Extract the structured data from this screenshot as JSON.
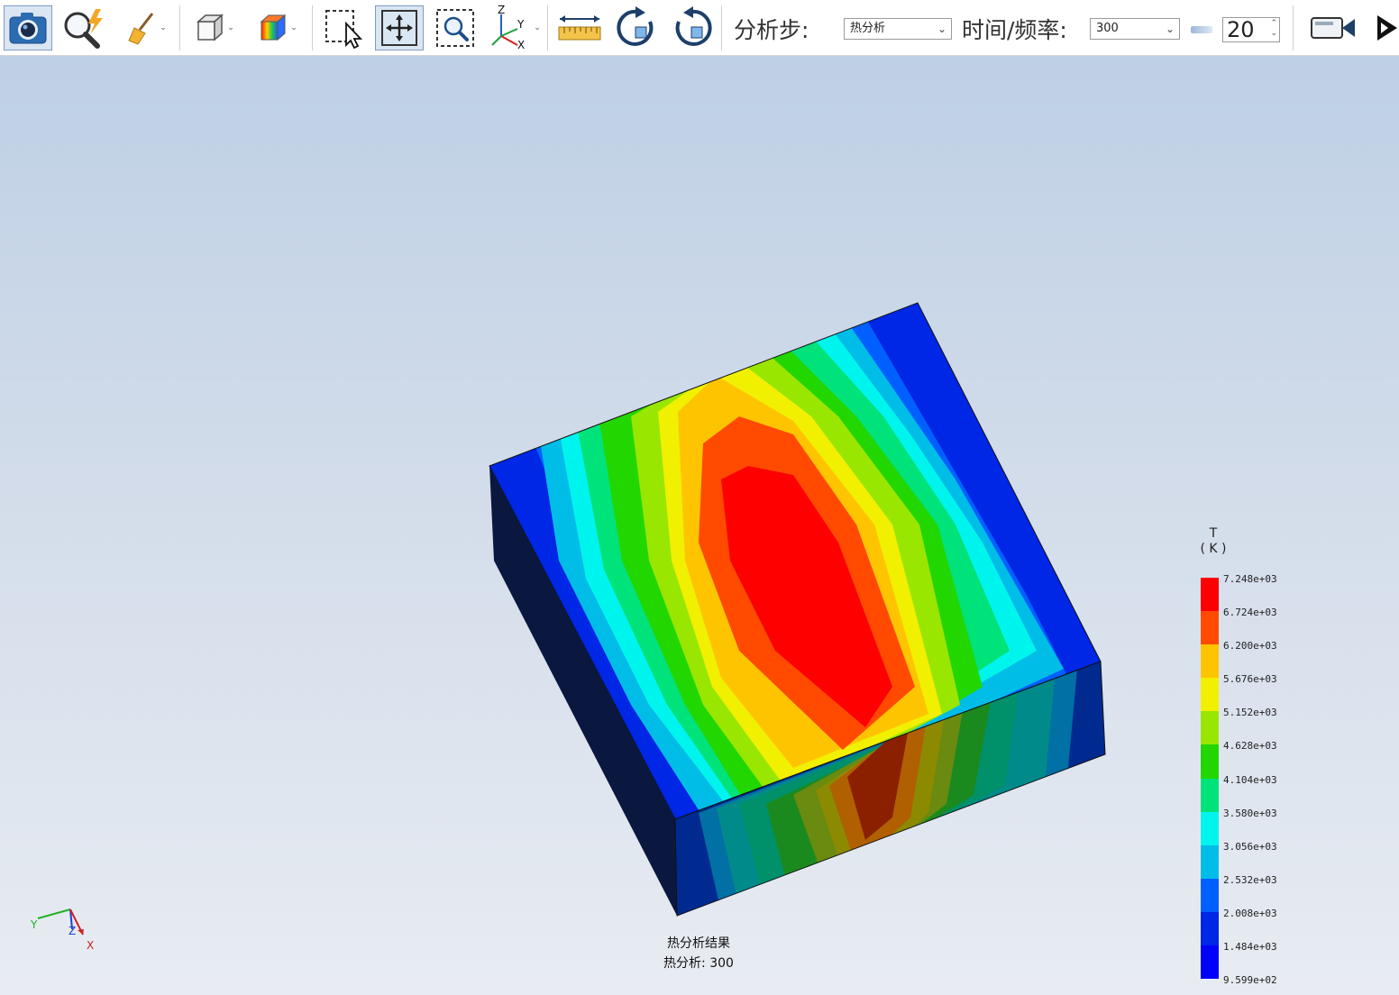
{
  "toolbar": {
    "buttons": [
      {
        "name": "screenshot",
        "icon": "camera-icon"
      },
      {
        "name": "quick-zoom",
        "icon": "magnifier-lightning-icon"
      },
      {
        "name": "clean",
        "icon": "broom-icon"
      },
      {
        "name": "view-cube",
        "icon": "cube-icon"
      },
      {
        "name": "contour",
        "icon": "color-contour-icon"
      },
      {
        "name": "select",
        "icon": "box-select-icon"
      },
      {
        "name": "pan",
        "icon": "pan-arrows-icon"
      },
      {
        "name": "zoom-window",
        "icon": "zoom-window-icon"
      },
      {
        "name": "axes",
        "icon": "xyz-axes-icon"
      },
      {
        "name": "measure",
        "icon": "ruler-icon"
      },
      {
        "name": "rotate-cw",
        "icon": "rotate-clockwise-icon"
      },
      {
        "name": "rotate-ccw",
        "icon": "rotate-counterclockwise-icon"
      },
      {
        "name": "record",
        "icon": "video-camera-icon"
      },
      {
        "name": "play",
        "icon": "play-icon"
      }
    ],
    "axes_icon_labels": {
      "z": "Z",
      "y": "Y",
      "x": "X"
    },
    "analysis_step_label": "分析步:",
    "analysis_step_value": "热分析",
    "time_freq_label": "时间/频率:",
    "time_freq_value": "300",
    "spin_value": "20"
  },
  "legend": {
    "quantity": "T",
    "unit": "( K )",
    "colors": [
      "#ff0000",
      "#ff4a00",
      "#ffc400",
      "#f0f000",
      "#99e600",
      "#22d600",
      "#00e27a",
      "#00f4ee",
      "#00bde8",
      "#0060ff",
      "#0026e6",
      "#0000ff"
    ],
    "labels": [
      "7.248e+03",
      "6.724e+03",
      "6.200e+03",
      "5.676e+03",
      "5.152e+03",
      "4.628e+03",
      "4.104e+03",
      "3.580e+03",
      "3.056e+03",
      "2.532e+03",
      "2.008e+03",
      "1.484e+03",
      "9.599e+02"
    ]
  },
  "caption": {
    "line1": "热分析结果",
    "line2": "热分析: 300"
  },
  "triad": {
    "y": "Y",
    "z": "Z",
    "x": "X"
  }
}
